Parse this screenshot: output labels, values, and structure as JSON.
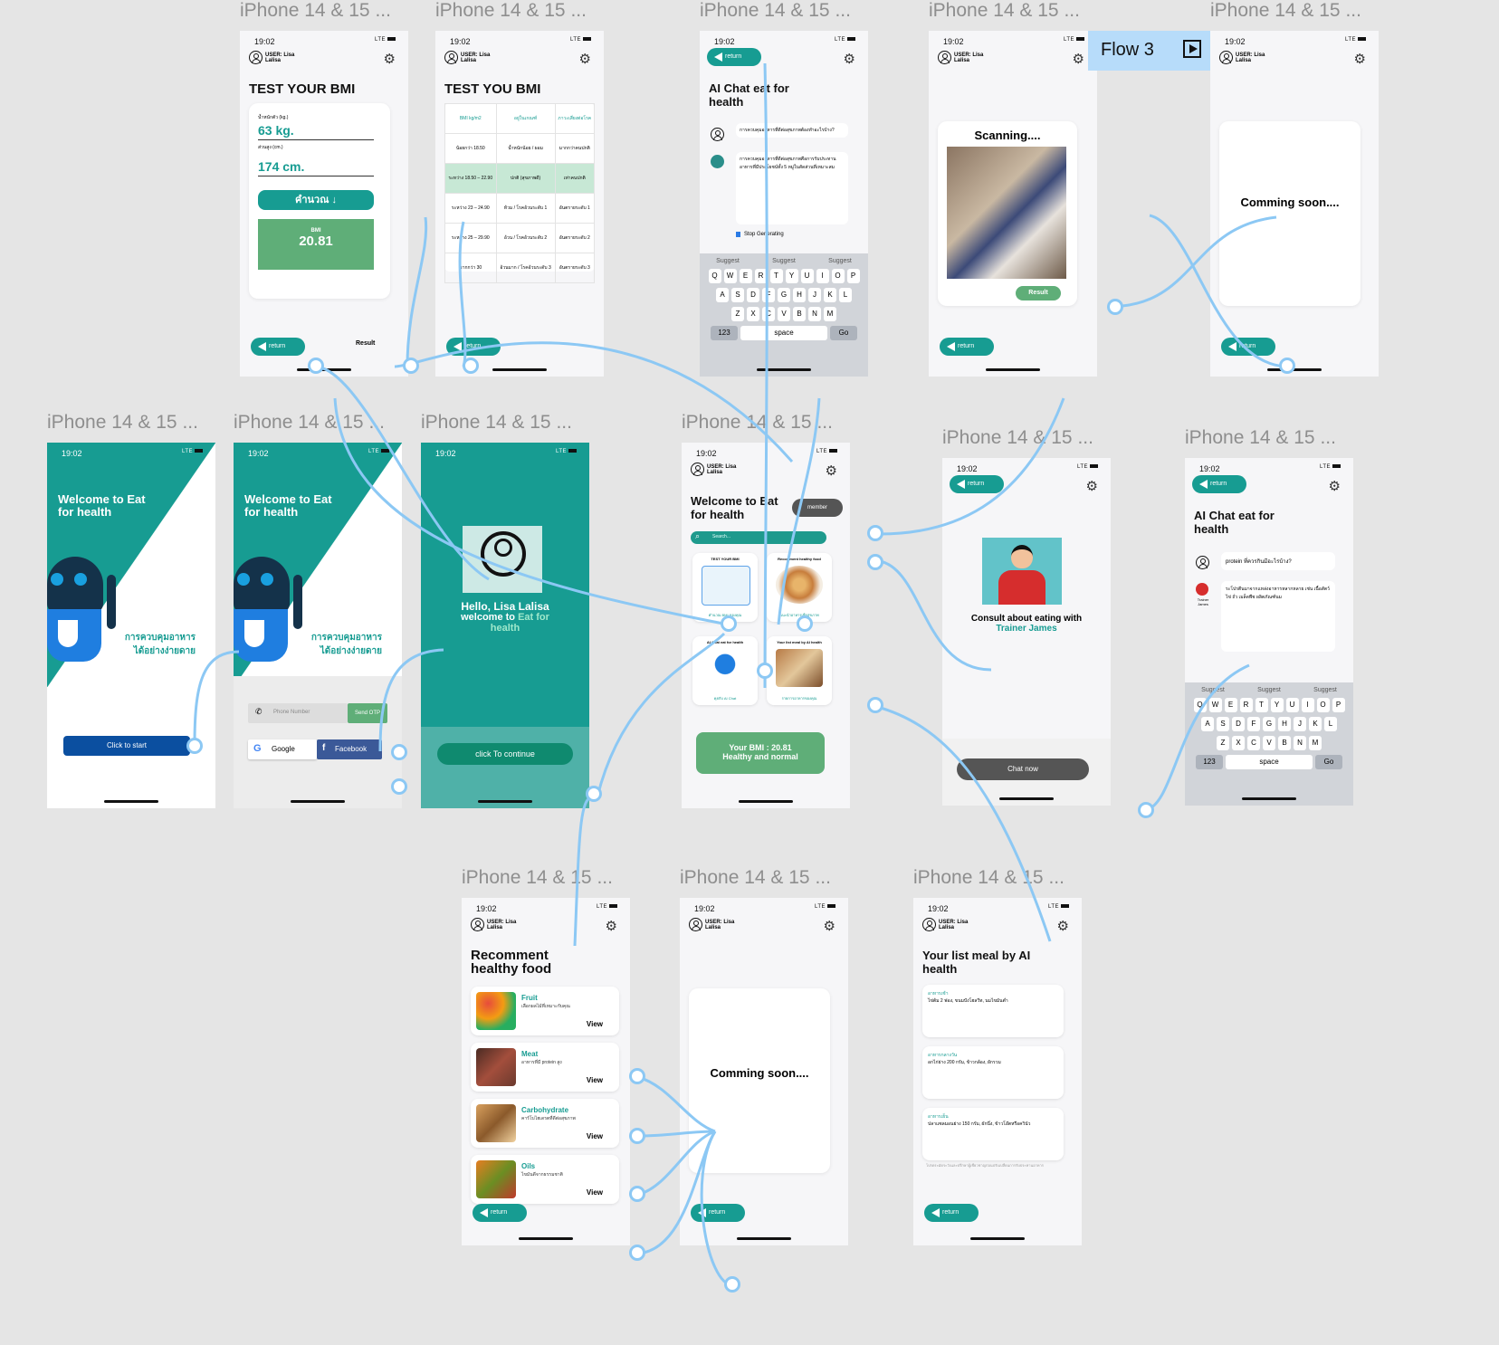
{
  "frame_label": "iPhone 14 & 15 ...",
  "flow_badge": "Flow 3",
  "status": {
    "time": "19:02",
    "signal": "LTE"
  },
  "user": {
    "name": "USER: Lisa Lalisa"
  },
  "common": {
    "return": "return",
    "result": "Result",
    "view": "View",
    "suggest": "Suggest",
    "space": "space",
    "num_key": "123",
    "go": "Go",
    "coming_soon": "Comming soon....",
    "search_placeholder": "Search..."
  },
  "keyboard": {
    "row1": [
      "Q",
      "W",
      "E",
      "R",
      "T",
      "Y",
      "U",
      "I",
      "O",
      "P"
    ],
    "row2": [
      "A",
      "S",
      "D",
      "F",
      "G",
      "H",
      "J",
      "K",
      "L"
    ],
    "row3": [
      "Z",
      "X",
      "C",
      "V",
      "B",
      "N",
      "M"
    ]
  },
  "welcome": {
    "title": "Welcome to Eat for health",
    "slogan": "การควบคุมอาหาร ได้อย่างง่ายดาย",
    "start_button": "Click to start",
    "phone_placeholder": "Phone Number",
    "send_otp": "Send OTP",
    "google": "Google",
    "facebook": "Facebook"
  },
  "hello": {
    "greeting": "Hello,  Lisa Lalisa",
    "welcome_prefix": "welcome to ",
    "welcome_app": "Eat for health",
    "continue_button": "click To continue"
  },
  "bmi_calc": {
    "title": "TEST YOUR BMI",
    "weight_label": "น้ำหนักตัว (kg.)",
    "weight_value": "63 kg.",
    "height_label": "ส่วนสูง (cm.)",
    "height_value": "174 cm.",
    "calc_button": "คำนวณ ↓",
    "bmi_label": "BMI",
    "bmi_value": "20.81",
    "result_link": "Result"
  },
  "bmi_table": {
    "title": "TEST YOU BMI",
    "headers": [
      "BMI kg/m2",
      "อยู่ในเกณฑ์",
      "ภาวะเสี่ยงต่อโรค"
    ],
    "rows": [
      [
        "น้อยกว่า 18.50",
        "น้ำหนักน้อย / ผอม",
        "มากกว่าคนปกติ"
      ],
      [
        "ระหว่าง 18.50 – 22.90",
        "ปกติ (สุขภาพดี)",
        "เท่าคนปกติ"
      ],
      [
        "ระหว่าง 23 – 24.90",
        "ท้วม / โรคอ้วนระดับ 1",
        "อันตรายระดับ 1"
      ],
      [
        "ระหว่าง 25 – 29.90",
        "อ้วน / โรคอ้วนระดับ 2",
        "อันตรายระดับ 2"
      ],
      [
        "มากกว่า 30",
        "อ้วนมาก / โรคอ้วนระดับ 3",
        "อันตรายระดับ 3"
      ]
    ]
  },
  "ai_chat": {
    "title": "AI Chat eat for health",
    "user_message": "การควบคุมอาหารที่ดีต่อสุขภาพต้องทำอะไรบ้าง?",
    "bot_message": "การควบคุมอาหารที่ดีต่อสุขภาพคือการรับประทานอาหารที่มีประโยชน์ทั้ง 5 หมู่ในสัดส่วนที่เหมาะสม",
    "stop_button": "Stop Generating"
  },
  "scan": {
    "title": "Scanning....",
    "result_button": "Result"
  },
  "home": {
    "title": "Welcome to Eat for health",
    "member_button": "member",
    "menu": [
      {
        "title": "TEST YOUR BMI",
        "caption": "คำนวณ BMI ของคุณ"
      },
      {
        "title": "Recomment healthy food",
        "caption": "แนะนำอาหารเพื่อสุขภาพ"
      },
      {
        "title": "AI Chat eat for health",
        "caption": "คุยกับ AI Chat"
      },
      {
        "title": "Your list meal by AI health",
        "caption": "รายการอาหารของคุณ"
      }
    ],
    "bmi_summary": "Your BMI : 20.81",
    "bmi_status": "Healthy and normal"
  },
  "trainer": {
    "title_prefix": "Consult about eating with ",
    "trainer_name": "Trainer James",
    "chat_button": "Chat now"
  },
  "ai_chat2": {
    "title": "AI Chat eat for health",
    "user_message": "protein ที่ควรกินมีอะไรบ้าง?",
    "bot_name": "Trainer James",
    "bot_message": "ระโปรตีนมาจากแหล่งอาหารหลากหลาย เช่น เนื้อสัตว์ ไข่ ถั่ว เมล็ดพืช ผลิตภัณฑ์นม"
  },
  "recommend": {
    "title": "Recomment healthy food",
    "items": [
      {
        "name": "Fruit",
        "desc": "เลือกผลไม้ที่เหมาะกับคุณ"
      },
      {
        "name": "Meat",
        "desc": "อาหารที่มี protein สูง"
      },
      {
        "name": "Carbohydrate",
        "desc": "คาร์โบไฮเดรตที่ดีต่อสุขภาพ"
      },
      {
        "name": "Oils",
        "desc": "ไขมันดีจากธรรมชาติ"
      }
    ]
  },
  "meal_list": {
    "title": "Your list meal by AI health",
    "meals": [
      {
        "name": "อาหารเช้า",
        "detail": "ไข่ต้ม 2 ฟอง, ขนมปังโฮลวีท, นมไขมันต่ำ"
      },
      {
        "name": "อาหารกลางวัน",
        "detail": "อกไก่ย่าง 200 กรัม, ข้าวกล้อง, ผักรวม"
      },
      {
        "name": "อาหารเย็น",
        "detail": "ปลาแซลมอนย่าง 150 กรัม, ผักนึ่ง, ข้าวโอ๊ตหรือควินัว"
      }
    ],
    "footnote": "โปรดระมัดระวังและปรึกษาผู้เชี่ยวชาญก่อนปรับเปลี่ยนการรับประทานอาหาร"
  },
  "colors": {
    "teal": "#179c92",
    "green": "#5fae78",
    "navy": "#0b4fa0",
    "link": "#8cc8f4"
  }
}
